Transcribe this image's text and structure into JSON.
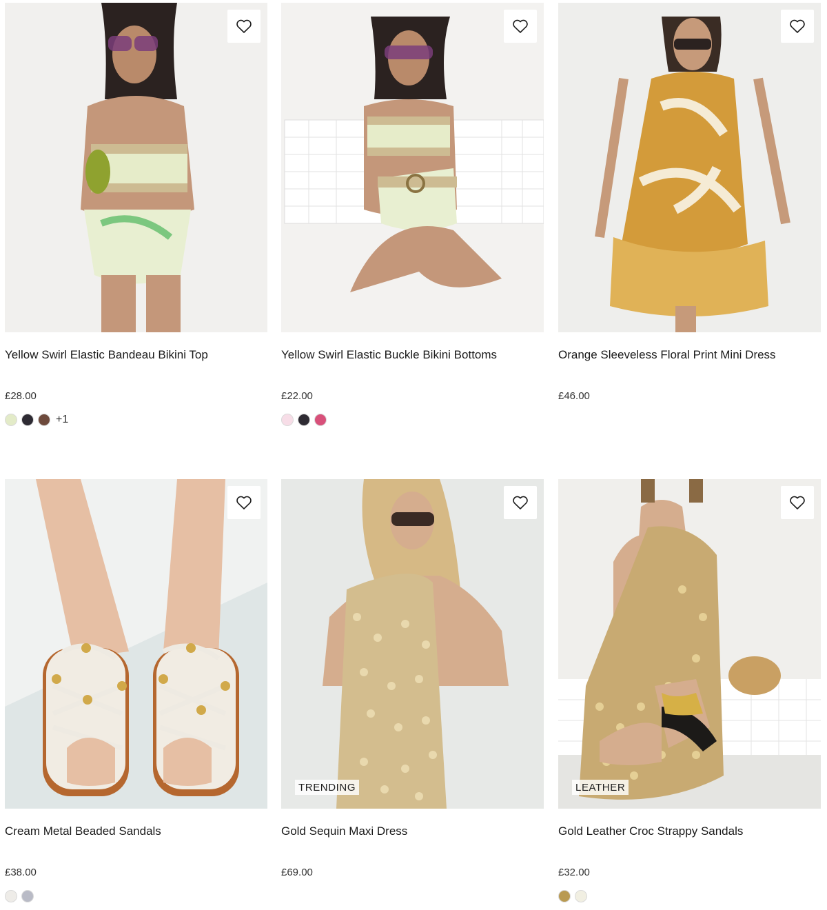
{
  "products": [
    {
      "name": "Yellow Swirl Elastic Bandeau Bikini Top",
      "price": "£28.00",
      "swatches": [
        "#e3ebc8",
        "#2e2b33",
        "#6e4a3c"
      ],
      "more": "+1",
      "tag": ""
    },
    {
      "name": "Yellow Swirl Elastic Buckle Bikini Bottoms",
      "price": "£22.00",
      "swatches": [
        "#f7dde7",
        "#2e2b33",
        "#d8507a"
      ],
      "more": "",
      "tag": ""
    },
    {
      "name": "Orange Sleeveless Floral Print Mini Dress",
      "price": "£46.00",
      "swatches": [],
      "more": "",
      "tag": ""
    },
    {
      "name": "Cream Metal Beaded Sandals",
      "price": "£38.00",
      "swatches": [
        "#eeece8",
        "#b9bbc6"
      ],
      "more": "",
      "tag": ""
    },
    {
      "name": "Gold Sequin Maxi Dress",
      "price": "£69.00",
      "swatches": [],
      "more": "",
      "tag": "TRENDING"
    },
    {
      "name": "Gold Leather Croc Strappy Sandals",
      "price": "£32.00",
      "swatches": [
        "#b99a52",
        "#f1efe2"
      ],
      "more": "",
      "tag": "LEATHER"
    }
  ],
  "icons": {
    "wishlist": "heart-outline-icon"
  },
  "colors": {
    "text": "#1a1a1a",
    "price": "#333333",
    "background": "#ffffff"
  }
}
